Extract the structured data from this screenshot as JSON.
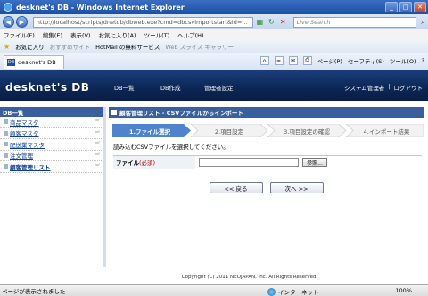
{
  "window": {
    "title": "desknet's DB - Windows Internet Explorer"
  },
  "address": {
    "url": "http://localhost/scripts/dnetdb/dbweb.exe?cmd=dbcsvimportstart&id=...",
    "search_placeholder": "Live Search"
  },
  "menu": [
    "ファイル(F)",
    "編集(E)",
    "表示(V)",
    "お気に入り(A)",
    "ツール(T)",
    "ヘルプ(H)"
  ],
  "favorites": {
    "label": "お気に入り",
    "item1": "おすすめサイト",
    "item2": "HotMail の無料サービス",
    "item3": "Web スライス ギャラリー"
  },
  "tab": {
    "label": "desknet's DB",
    "icon_text": "DB"
  },
  "commands": {
    "page": "ページ(P)",
    "safety": "セーフティ(S)",
    "tools": "ツール(O)",
    "help": "?"
  },
  "app": {
    "logo": "desknet's DB",
    "nav": [
      "DB一覧",
      "DB作成",
      "管理者設定"
    ],
    "right": {
      "user": "システム管理者",
      "sep": "|",
      "logout": "ログアウト"
    }
  },
  "sidebar": {
    "title": "DB一覧",
    "items": [
      {
        "label": "商品マスタ"
      },
      {
        "label": "顧客マスタ"
      },
      {
        "label": "配送業マスタ"
      },
      {
        "label": "注文管理"
      },
      {
        "label": "顧客管理リスト"
      }
    ]
  },
  "main": {
    "title": "顧客管理リスト - CSVファイルからインポート",
    "steps": [
      "1.ファイル選択",
      "2.項目設定",
      "3.項目設定の確認",
      "4.インポート結果"
    ],
    "instruction": "読み込むCSVファイルを選択してください。",
    "file_label": "ファイル",
    "required": "(必須)",
    "browse": "参照...",
    "back": "<< 戻る",
    "next": "次へ >>"
  },
  "footer": "Copyright (C) 2011 NEOJAPAN, Inc. All Rights Reserved.",
  "status": {
    "text": "ページが表示されました",
    "zone": "インターネット",
    "zoom": "100%"
  },
  "colors": {
    "titlebar": "#1d4fa3",
    "header": "#0c2654",
    "panel_head": "#3a5f9e",
    "active_step": "#4f83cf"
  }
}
